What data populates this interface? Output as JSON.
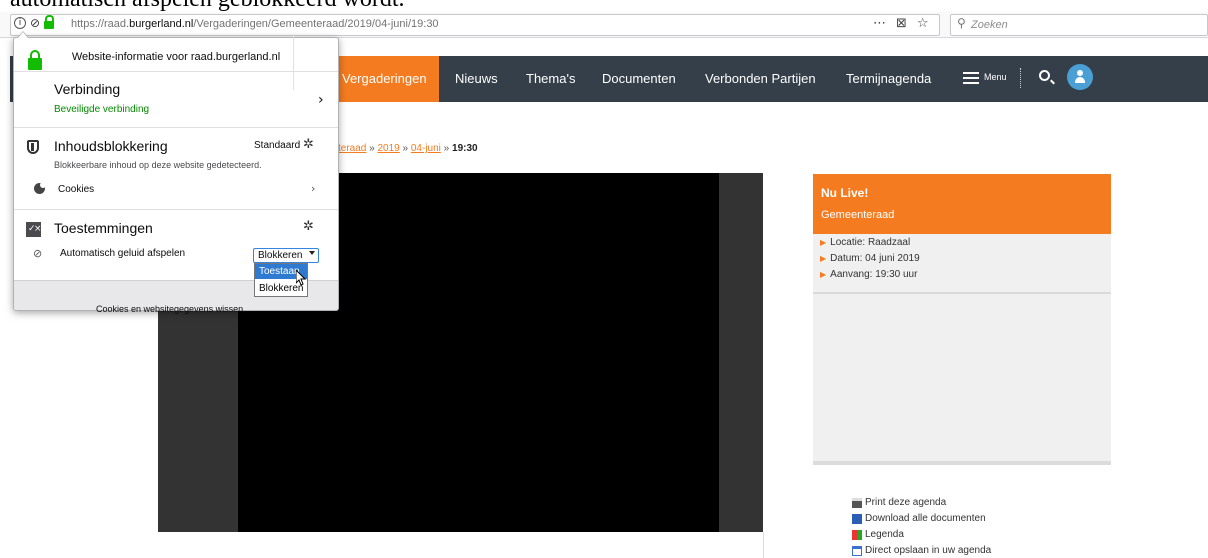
{
  "caption": "automatisch afspelen geblokkeerd wordt.",
  "browser": {
    "url_prefix": "https://raad.",
    "url_domain": "burgerland.nl",
    "url_path": "/Vergaderingen/Gemeenteraad/2019/04-juni/19:30",
    "page_actions_icon": "⋯",
    "pocket_icon": "⊠",
    "bookmark_icon": "☆",
    "search_placeholder": "Zoeken"
  },
  "site_nav": {
    "items": [
      "Vergaderingen",
      "Nieuws",
      "Thema's",
      "Documenten",
      "Verbonden Partijen",
      "Termijnagenda"
    ],
    "menu_label": "Menu",
    "active_color": "#f47b20",
    "bar_color": "#343f49"
  },
  "breadcrumb": {
    "partial": "teraad",
    "sep": "»",
    "year": "2019",
    "date": "04-juni",
    "current": "19:30"
  },
  "live_panel": {
    "title": "Nu Live!",
    "subtitle": "Gemeenteraad",
    "items": [
      "Locatie: Raadzaal",
      "Datum: 04 juni 2019",
      "Aanvang: 19:30 uur"
    ]
  },
  "agenda_links": [
    "Print deze agenda",
    "Download alle documenten",
    "Legenda",
    "Direct opslaan in uw agenda"
  ],
  "popup": {
    "header": "Website-informatie voor raad.burgerland.nl",
    "connection_title": "Verbinding",
    "connection_status": "Beveiligde verbinding",
    "content_blocking_title": "Inhoudsblokkering",
    "content_blocking_mode": "Standaard",
    "content_blocking_text": "Blokkeerbare inhoud op deze website gedetecteerd.",
    "cookies_label": "Cookies",
    "permissions_title": "Toestemmingen",
    "autoplay_label": "Automatisch geluid afspelen",
    "autoplay_value": "Blokkeren",
    "autoplay_options": [
      "Toestaan",
      "Blokkeren"
    ],
    "footer": "Cookies en websitegegevens wissen…"
  }
}
